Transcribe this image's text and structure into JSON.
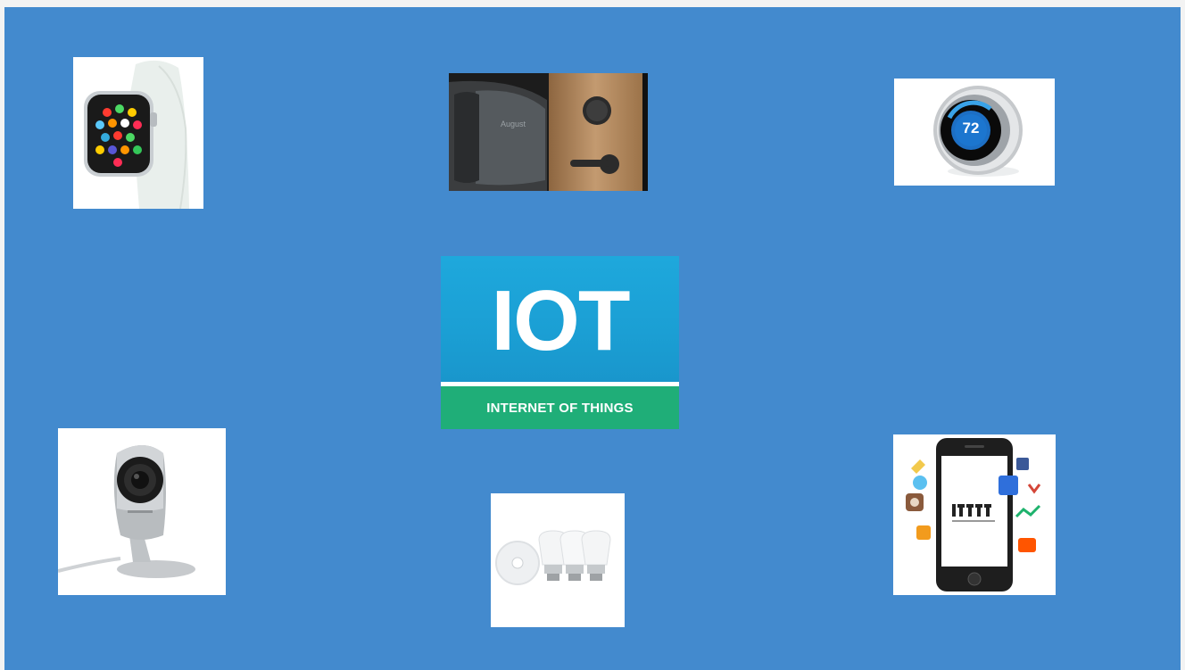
{
  "logo": {
    "title": "IOT",
    "subtitle": "INTERNET OF THINGS"
  },
  "devices": {
    "thermostat_reading": "72"
  },
  "colors": {
    "slide_background": "#438ace",
    "logo_top": "#1ea8dc",
    "logo_bottom": "#1fae78"
  },
  "images": [
    {
      "icon": "smartwatch-icon"
    },
    {
      "icon": "smart-lock-icon"
    },
    {
      "icon": "thermostat-icon"
    },
    {
      "icon": "security-camera-icon"
    },
    {
      "icon": "smart-bulbs-icon"
    },
    {
      "icon": "smartphone-apps-icon"
    }
  ]
}
